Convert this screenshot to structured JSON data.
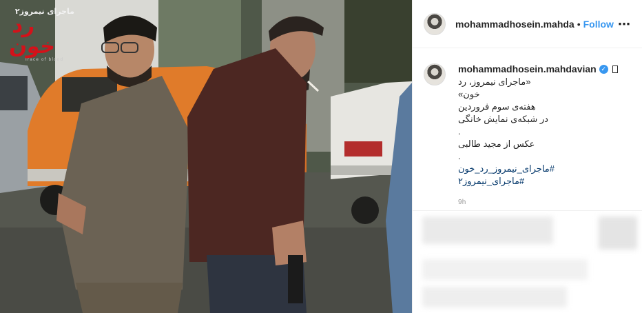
{
  "post": {
    "username": "mohammadhosein.mahda",
    "separator": "•",
    "follow_label": "Follow",
    "more_icon": "more-options-icon"
  },
  "caption": {
    "username": "mohammadhosein.mahdavian",
    "verified_icon": "verified-badge-icon",
    "lines": [
      "«ماجرای نیمروز، رد خون»",
      "هفته‌ی سوم فروردین",
      "در شبکه‌ی نمایش خانگی",
      ".",
      "عکس از مجید طالبی",
      "."
    ],
    "hashtags": [
      "#ماجرای_نیمروز_رد_خون",
      "#ماجرای_نیمروز۲"
    ],
    "time": "9h"
  },
  "photo": {
    "logo_small": "ماجرای نیمروز۲",
    "logo_big": "رد خون",
    "logo_tag": "Trace of blood"
  },
  "colors": {
    "accent": "#3897f0",
    "hashtag": "#003569",
    "muted": "#999999",
    "logo_red": "#d3121a"
  }
}
